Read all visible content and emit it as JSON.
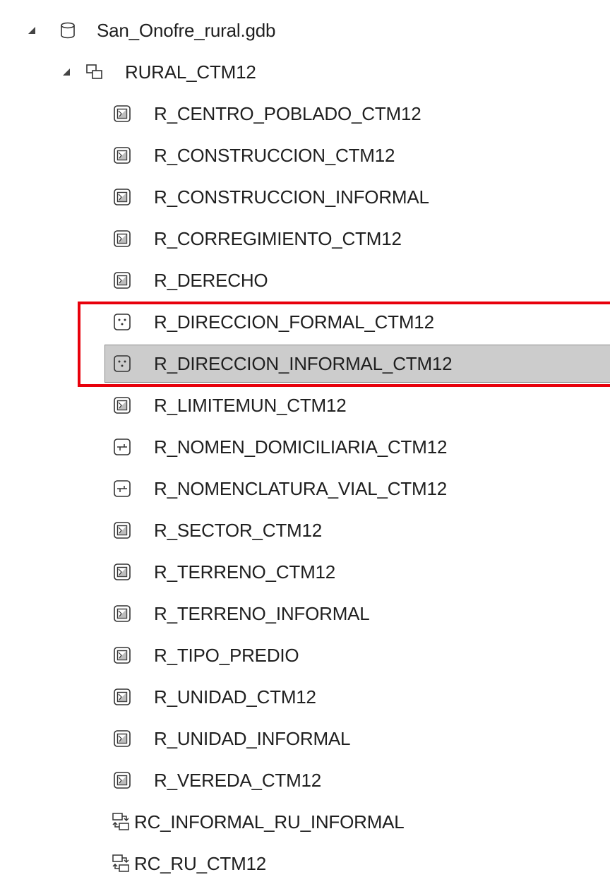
{
  "tree": {
    "geodatabase": {
      "label": "San_Onofre_rural.gdb",
      "icon": "geodatabase-icon"
    },
    "dataset": {
      "label": "RURAL_CTM12",
      "icon": "feature-dataset-icon"
    },
    "items": [
      {
        "label": "R_CENTRO_POBLADO_CTM12",
        "icon": "polygon-feature-class-icon"
      },
      {
        "label": "R_CONSTRUCCION_CTM12",
        "icon": "polygon-feature-class-icon"
      },
      {
        "label": "R_CONSTRUCCION_INFORMAL",
        "icon": "polygon-feature-class-icon"
      },
      {
        "label": "R_CORREGIMIENTO_CTM12",
        "icon": "polygon-feature-class-icon"
      },
      {
        "label": "R_DERECHO",
        "icon": "polygon-feature-class-icon"
      },
      {
        "label": "R_DIRECCION_FORMAL_CTM12",
        "icon": "point-feature-class-icon"
      },
      {
        "label": "R_DIRECCION_INFORMAL_CTM12",
        "icon": "point-feature-class-icon",
        "selected": true
      },
      {
        "label": "R_LIMITEMUN_CTM12",
        "icon": "polygon-feature-class-icon"
      },
      {
        "label": "R_NOMEN_DOMICILIARIA_CTM12",
        "icon": "line-feature-class-icon"
      },
      {
        "label": "R_NOMENCLATURA_VIAL_CTM12",
        "icon": "line-feature-class-icon"
      },
      {
        "label": "R_SECTOR_CTM12",
        "icon": "polygon-feature-class-icon"
      },
      {
        "label": "R_TERRENO_CTM12",
        "icon": "polygon-feature-class-icon"
      },
      {
        "label": "R_TERRENO_INFORMAL",
        "icon": "polygon-feature-class-icon"
      },
      {
        "label": "R_TIPO_PREDIO",
        "icon": "polygon-feature-class-icon"
      },
      {
        "label": "R_UNIDAD_CTM12",
        "icon": "polygon-feature-class-icon"
      },
      {
        "label": "R_UNIDAD_INFORMAL",
        "icon": "polygon-feature-class-icon"
      },
      {
        "label": "R_VEREDA_CTM12",
        "icon": "polygon-feature-class-icon"
      },
      {
        "label": "RC_INFORMAL_RU_INFORMAL",
        "icon": "relationship-class-icon"
      },
      {
        "label": "RC_RU_CTM12",
        "icon": "relationship-class-icon"
      }
    ]
  },
  "colors": {
    "selection_background": "#cccccc",
    "annotation_red": "#e8000b"
  }
}
